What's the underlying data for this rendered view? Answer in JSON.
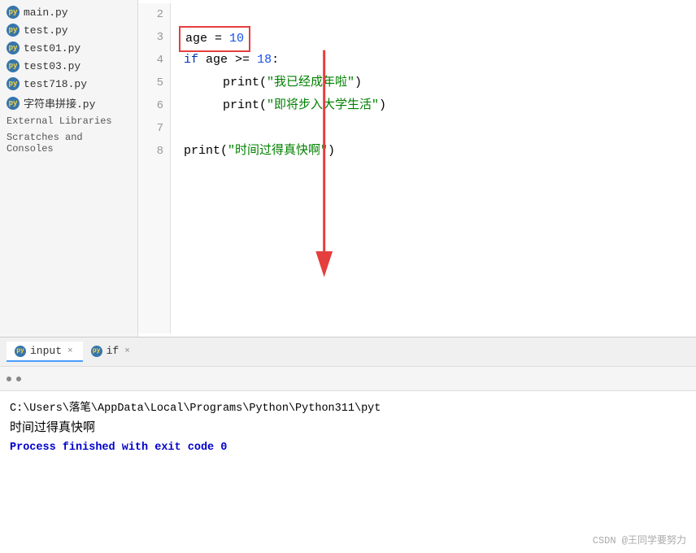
{
  "sidebar": {
    "items": [
      {
        "label": "main.py",
        "icon": "py"
      },
      {
        "label": "test.py",
        "icon": "py"
      },
      {
        "label": "test01.py",
        "icon": "py"
      },
      {
        "label": "test03.py",
        "icon": "py"
      },
      {
        "label": "test718.py",
        "icon": "py"
      },
      {
        "label": "字符串拼接.py",
        "icon": "py"
      },
      {
        "label": "External Libraries",
        "icon": "folder"
      },
      {
        "label": "Scratches and Consoles",
        "icon": "folder"
      }
    ]
  },
  "editor": {
    "lines": [
      {
        "num": "2",
        "content": ""
      },
      {
        "num": "3",
        "content": "age_line",
        "highlighted": true
      },
      {
        "num": "4",
        "content": "if_line"
      },
      {
        "num": "5",
        "content": "print1_line"
      },
      {
        "num": "6",
        "content": "print2_line"
      },
      {
        "num": "7",
        "content": ""
      },
      {
        "num": "8",
        "content": "print3_line"
      }
    ],
    "code": {
      "age_assignment": "age = 10",
      "age_var": "age",
      "age_eq": " = ",
      "age_num": "10",
      "if_kw": "if",
      "if_age": "age",
      "if_op": " >= ",
      "if_num": "18",
      "if_colon": ":",
      "print_fn": "print",
      "str1": "\"我已经成年啦\"",
      "str2": "\"即将步入大学生活\"",
      "str3": "\"时间过得真快啊\""
    }
  },
  "tabs": [
    {
      "label": "input",
      "active": true,
      "closable": true
    },
    {
      "label": "if",
      "active": false,
      "closable": true
    }
  ],
  "terminal": {
    "path": "C:\\Users\\落笔\\AppData\\Local\\Programs\\Python\\Python311\\pyt",
    "output": "时间过得真快啊",
    "process": "Process finished with exit code 0"
  },
  "watermark": "CSDN @王同学要努力"
}
